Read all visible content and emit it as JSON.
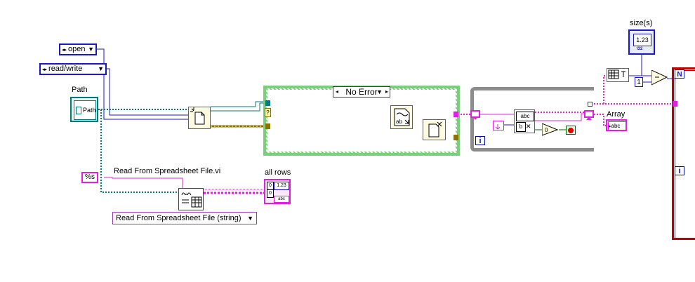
{
  "controls": {
    "open_ring": "open",
    "readwrite_ring": "read/write",
    "path_label": "Path",
    "path_text": "Path",
    "format_const": "%s",
    "size_label": "size(s)",
    "size_value": "1.23",
    "size_type": "I32",
    "all_rows_label": "all rows",
    "all_rows_value": "1.23",
    "all_rows_text": "abc",
    "array_label": "Array",
    "array_text": "abc",
    "one_const": "1",
    "n_terminal": "N"
  },
  "subvi": {
    "read_spreadsheet_label": "Read From Spreadsheet File.vi",
    "polymorphic_selector": "Read From Spreadsheet File (string)",
    "string_func_top": "abc",
    "string_func_bottom": "b",
    "zero_const": "0"
  },
  "case_structure": {
    "selector_value": "No Error"
  },
  "loops": {
    "iteration_terminal": "i"
  },
  "colors": {
    "file_ref_wire": "#007b7b",
    "path_wire": "#007b7b",
    "enum_wire": "#1818c8",
    "string_wire": "#e020e0",
    "error_wire": "#8b7300",
    "case_border": "#7ad07a",
    "while_border": "#8c8c8c",
    "for_border": "#c00000"
  }
}
